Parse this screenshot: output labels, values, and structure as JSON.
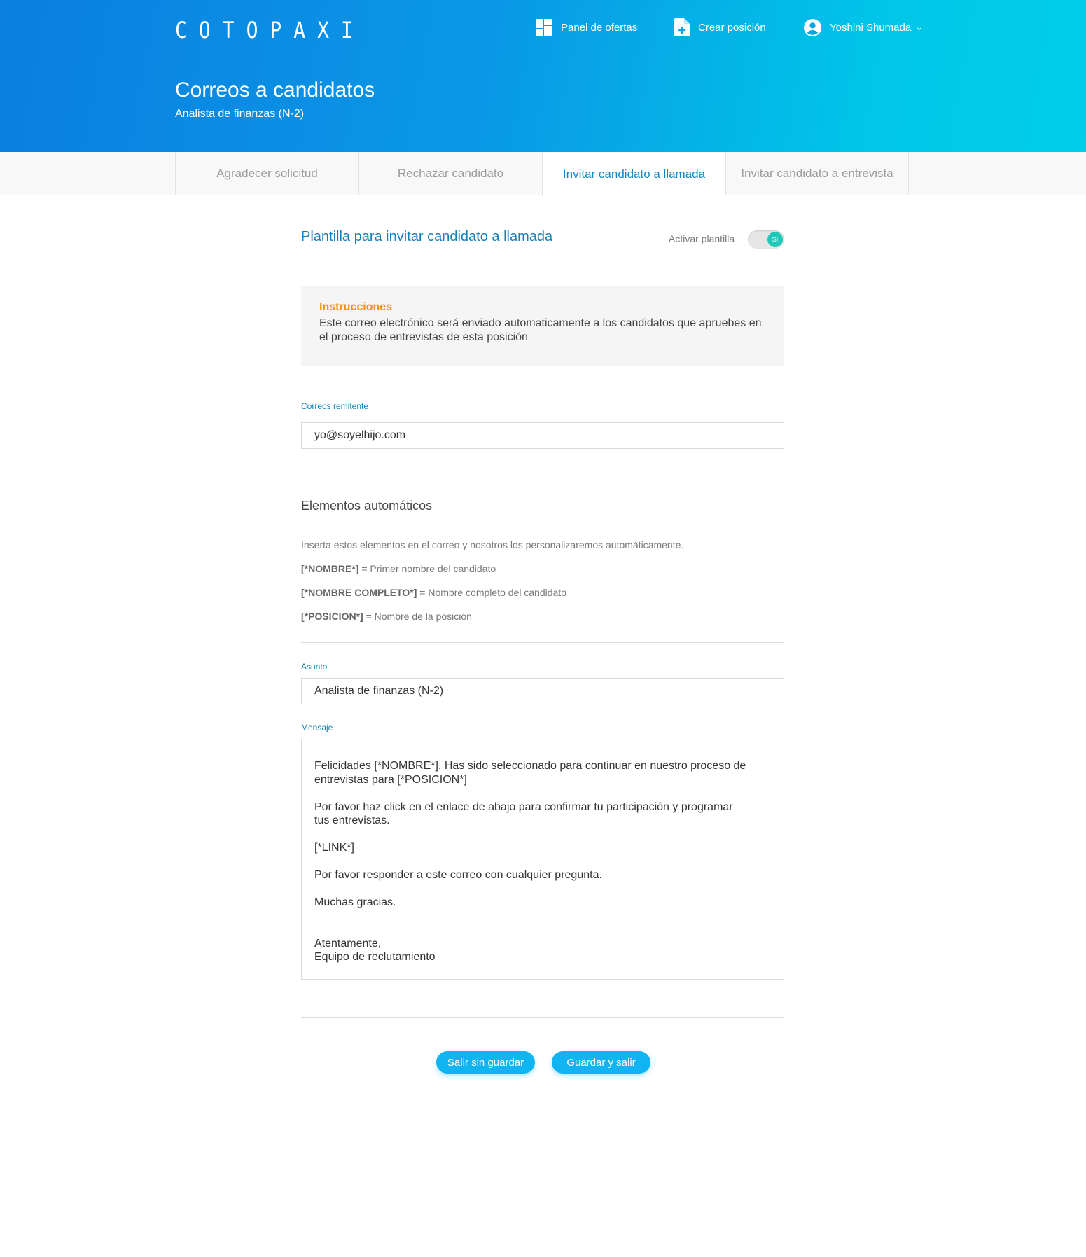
{
  "brand": {
    "logo": "COTOPAXI"
  },
  "nav": {
    "panel_label": "Panel de ofertas",
    "crear_label": "Crear posición",
    "user_name": "Yoshini Shumada",
    "user_caret": "⌄"
  },
  "header": {
    "title": "Correos a candidatos",
    "subtitle": "Analista de finanzas (N-2)"
  },
  "tabs": [
    {
      "label": "Agradecer solicitud"
    },
    {
      "label": "Rechazar candidato"
    },
    {
      "label": "Invitar candidato a llamada",
      "active": true
    },
    {
      "label": "Invitar candidato a entrevista"
    }
  ],
  "template": {
    "title": "Plantilla para invitar candidato a llamada",
    "toggle_label": "Activar plantilla",
    "toggle_value": "SI"
  },
  "instructions": {
    "title": "Instrucciones",
    "body": "Este correo electrónico será enviado automaticamente a los candidatos que apruebes en el proceso de entrevistas de esta posición"
  },
  "sender": {
    "label": "Correos remitente",
    "value": "yo@soyelhijo.com"
  },
  "auto_elements": {
    "title": "Elementos automáticos",
    "intro": "Inserta estos elementos en el correo y nosotros los personalizaremos automáticamente.",
    "items": [
      {
        "tag": "[*NOMBRE*]",
        "desc": " = Primer nombre del candidato"
      },
      {
        "tag": "[*NOMBRE COMPLETO*]",
        "desc": " = Nombre completo del candidato"
      },
      {
        "tag": "[*POSICION*]",
        "desc": " = Nombre de la posición"
      }
    ]
  },
  "subject": {
    "label": "Asunto",
    "value": "Analista de finanzas (N-2)"
  },
  "message": {
    "label": "Mensaje",
    "body": "Felicidades [*NOMBRE*]. Has sido seleccionado para continuar en nuestro proceso de\nentrevistas para [*POSICION*]\n\nPor favor haz click en el enlace de abajo para confirmar tu participación y programar\ntus entrevistas.\n\n[*LINK*]\n\nPor favor responder a este correo con cualquier pregunta.\n\nMuchas gracias.\n\n\nAtentamente,\nEquipo de reclutamiento"
  },
  "actions": {
    "exit_label": "Salir sin guardar",
    "save_label": "Guardar y salir"
  },
  "colors": {
    "header_gradient_start": "#0a7fe0",
    "header_gradient_end": "#00cfe9",
    "accent": "#1480b8",
    "instructions_title": "#f29111",
    "toggle_on": "#1fc8b8",
    "button": "#0fb4f0"
  }
}
